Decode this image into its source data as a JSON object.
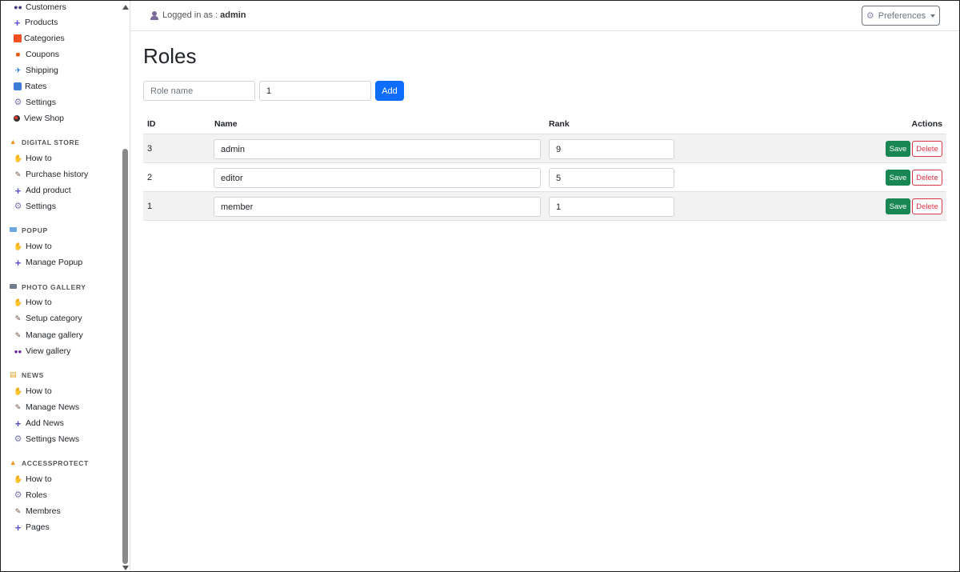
{
  "sidebar": {
    "top_items": [
      {
        "label": "Customers",
        "icon": "people-icon"
      },
      {
        "label": "Products",
        "icon": "plus-icon"
      },
      {
        "label": "Categories",
        "icon": "square-icon"
      },
      {
        "label": "Coupons",
        "icon": "gift-icon"
      },
      {
        "label": "Shipping",
        "icon": "plane-icon"
      },
      {
        "label": "Rates",
        "icon": "rates-icon"
      },
      {
        "label": "Settings",
        "icon": "gear-icon"
      },
      {
        "label": "View Shop",
        "icon": "dot-icon"
      }
    ],
    "sections": [
      {
        "title": "DIGITAL STORE",
        "icon": "fire-icon",
        "items": [
          {
            "label": "How to",
            "icon": "hand-icon"
          },
          {
            "label": "Purchase history",
            "icon": "pen-icon"
          },
          {
            "label": "Add product",
            "icon": "plus-icon"
          },
          {
            "label": "Settings",
            "icon": "gear-icon"
          }
        ]
      },
      {
        "title": "POPUP",
        "icon": "card-icon",
        "items": [
          {
            "label": "How to",
            "icon": "hand-icon"
          },
          {
            "label": "Manage Popup",
            "icon": "plus-icon"
          }
        ]
      },
      {
        "title": "PHOTO GALLERY",
        "icon": "photo-icon",
        "items": [
          {
            "label": "How to",
            "icon": "hand-icon"
          },
          {
            "label": "Setup category",
            "icon": "pen-icon"
          },
          {
            "label": "Manage gallery",
            "icon": "pen-icon"
          },
          {
            "label": "View gallery",
            "icon": "eyes-icon"
          }
        ]
      },
      {
        "title": "NEWS",
        "icon": "scroll-icon",
        "items": [
          {
            "label": "How to",
            "icon": "hand-icon"
          },
          {
            "label": "Manage News",
            "icon": "pen-icon"
          },
          {
            "label": "Add News",
            "icon": "plus-icon"
          },
          {
            "label": "Settings News",
            "icon": "gear-icon"
          }
        ]
      },
      {
        "title": "ACCESSPROTECT",
        "icon": "fire-icon",
        "items": [
          {
            "label": "How to",
            "icon": "hand-icon"
          },
          {
            "label": "Roles",
            "icon": "gear-icon"
          },
          {
            "label": "Membres",
            "icon": "pen-icon"
          },
          {
            "label": "Pages",
            "icon": "plus-icon"
          }
        ]
      }
    ]
  },
  "topbar": {
    "logged_in_prefix": "Logged in as :",
    "username": "admin",
    "preferences_label": "Preferences"
  },
  "main": {
    "title": "Roles",
    "add_form": {
      "role_name_placeholder": "Role name",
      "rank_value": "1",
      "add_label": "Add"
    },
    "table": {
      "headers": {
        "id": "ID",
        "name": "Name",
        "rank": "Rank",
        "actions": "Actions"
      },
      "rows": [
        {
          "id": "3",
          "name": "admin",
          "rank": "9"
        },
        {
          "id": "2",
          "name": "editor",
          "rank": "5"
        },
        {
          "id": "1",
          "name": "member",
          "rank": "1"
        }
      ],
      "save_label": "Save",
      "delete_label": "Delete"
    }
  },
  "colors": {
    "primary": "#0d6efd",
    "success": "#198754",
    "danger": "#dc3545"
  }
}
